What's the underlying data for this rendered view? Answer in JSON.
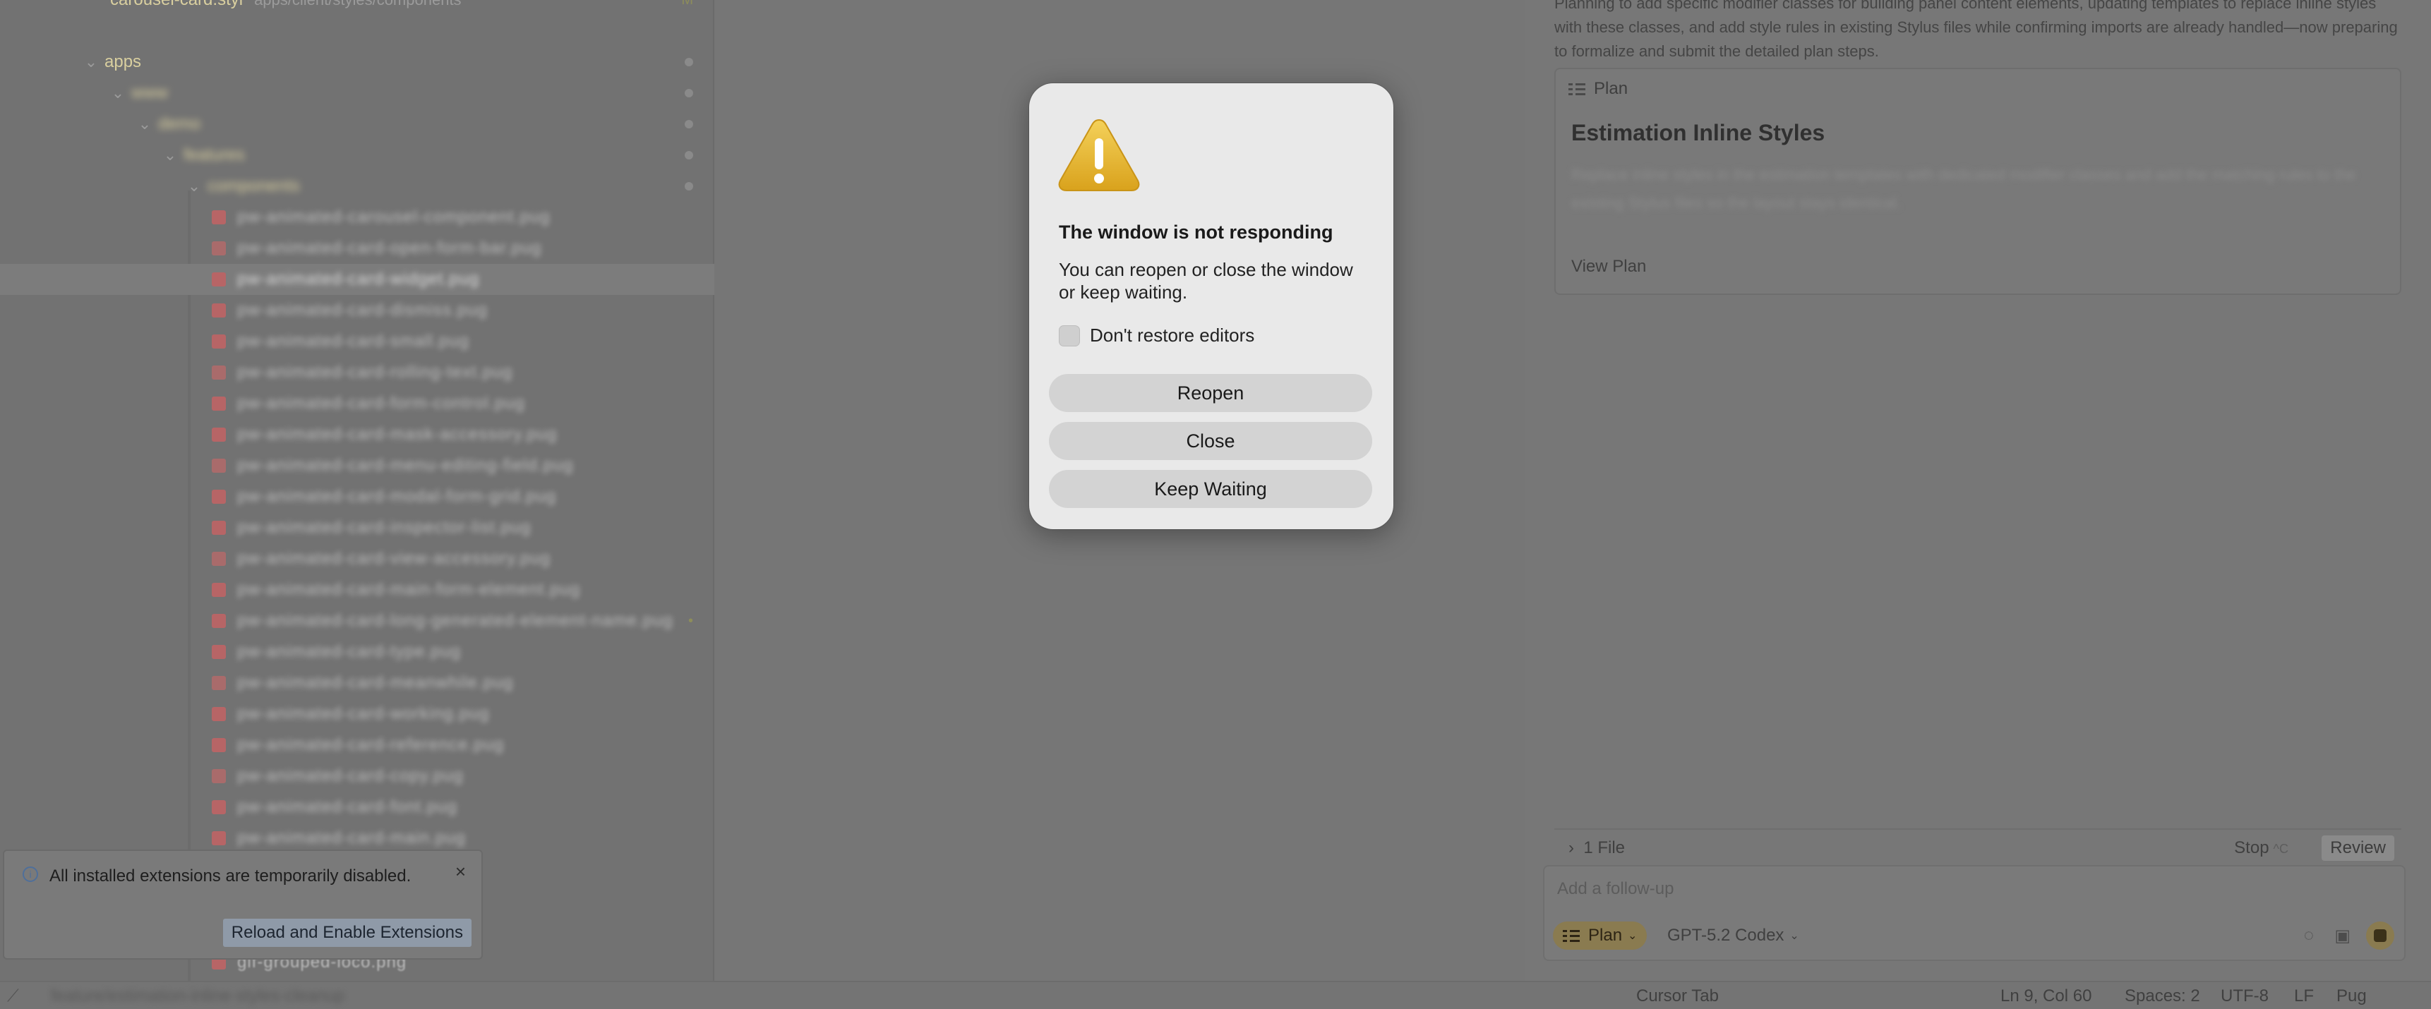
{
  "sidebar": {
    "top_file": {
      "name": "carousel-card.styl",
      "path": "apps/client/styles/components",
      "status": "M"
    },
    "folders": [
      {
        "label": "apps"
      },
      {
        "label": "www"
      },
      {
        "label": "demo"
      },
      {
        "label": "features"
      },
      {
        "label": "components"
      }
    ],
    "files": [
      "pw-animated-carousel-component.pug",
      "pw-animated-card-open-form-bar.pug",
      "pw-animated-card-widget.pug",
      "pw-animated-card-dismiss.pug",
      "pw-animated-card-small.pug",
      "pw-animated-card-rolling-text.pug",
      "pw-animated-card-form-control.pug",
      "pw-animated-card-mask-accessory.pug",
      "pw-animated-card-menu-editing-field.pug",
      "pw-animated-card-modal-form-grid.pug",
      "pw-animated-card-inspector-list.pug",
      "pw-animated-card-view-accessory.pug",
      "pw-animated-card-main-form-element.pug",
      "pw-animated-card-long-generated-element-name.pug",
      "pw-animated-card-type.pug",
      "pw-animated-card-meanwhile.pug",
      "pw-animated-card-working.pug",
      "pw-animated-card-reference.pug",
      "pw-animated-card-copy.pug",
      "pw-animated-card-font.pug",
      "pw-animated-card-main.pug"
    ],
    "bottom_file": "gif-grouped-loco.png"
  },
  "toast": {
    "message": "All installed extensions are temporarily disabled.",
    "close_icon": "close-icon",
    "info_icon": "info-icon",
    "button_label": "Reload and Enable Extensions"
  },
  "agent_panel": {
    "description": "Planning to add specific modifier classes for building panel content elements, updating templates to replace inline styles with these classes, and add style rules in existing Stylus files while confirming imports are already handled—now preparing to formalize and submit the detailed plan steps.",
    "plan": {
      "header_label": "Plan",
      "title": "Estimation Inline Styles",
      "body": "Replace inline styles in the estimation templates with dedicated modifier classes and add the matching rules to the existing Stylus files so the layout stays identical.",
      "view_label": "View Plan"
    },
    "files_label": "1 File",
    "stop_label": "Stop",
    "stop_shortcut": "^C",
    "review_label": "Review",
    "input_placeholder": "Add a follow-up",
    "mode_label": "Plan",
    "model_label": "GPT-5.2 Codex"
  },
  "status_bar": {
    "branch_text": "feature/estimation-inline-styles-cleanup",
    "cursor_tab": "Cursor Tab",
    "position": "Ln 9, Col 60",
    "spaces": "Spaces: 2",
    "encoding": "UTF-8",
    "eol": "LF",
    "language": "Pug"
  },
  "dialog": {
    "icon": "warning-icon",
    "title": "The window is not responding",
    "message": "You can reopen or close the window or keep waiting.",
    "checkbox_label": "Don't restore editors",
    "checkbox_checked": false,
    "buttons": {
      "reopen": "Reopen",
      "close": "Close",
      "keep_waiting": "Keep Waiting"
    }
  },
  "colors": {
    "dim_background": "#767676",
    "dialog_background": "#e9e9e9",
    "dialog_button": "#d3d3d3",
    "warning_yellow": "#e3b52a",
    "accent_gold": "#8a7b50"
  }
}
